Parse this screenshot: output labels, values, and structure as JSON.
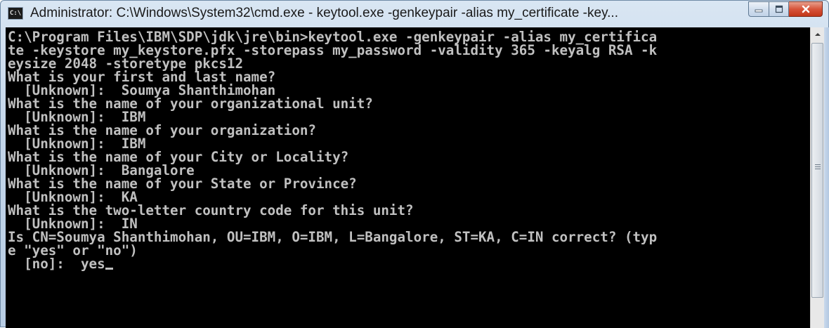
{
  "window": {
    "title": "Administrator: C:\\Windows\\System32\\cmd.exe - keytool.exe  -genkeypair -alias my_certificate -key...",
    "icon": "cmd-icon",
    "icon_text": "C:\\"
  },
  "caption_buttons": [
    "minimize-icon",
    "maximize-icon",
    "close-icon"
  ],
  "console": {
    "lines": [
      "C:\\Program Files\\IBM\\SDP\\jdk\\jre\\bin>keytool.exe -genkeypair -alias my_certifica",
      "te -keystore my_keystore.pfx -storepass my_password -validity 365 -keyalg RSA -k",
      "eysize 2048 -storetype pkcs12",
      "What is your first and last name?",
      "  [Unknown]:  Soumya Shanthimohan",
      "What is the name of your organizational unit?",
      "  [Unknown]:  IBM",
      "What is the name of your organization?",
      "  [Unknown]:  IBM",
      "What is the name of your City or Locality?",
      "  [Unknown]:  Bangalore",
      "What is the name of your State or Province?",
      "  [Unknown]:  KA",
      "What is the two-letter country code for this unit?",
      "  [Unknown]:  IN",
      "Is CN=Soumya Shanthimohan, OU=IBM, O=IBM, L=Bangalore, ST=KA, C=IN correct? (typ",
      "e \"yes\" or \"no\")",
      "  [no]:  yes"
    ]
  },
  "colors": {
    "console_bg": "#000000",
    "console_fg": "#c0c0c0",
    "close_button": "#c8452a",
    "frame": "#c4d6ea"
  }
}
